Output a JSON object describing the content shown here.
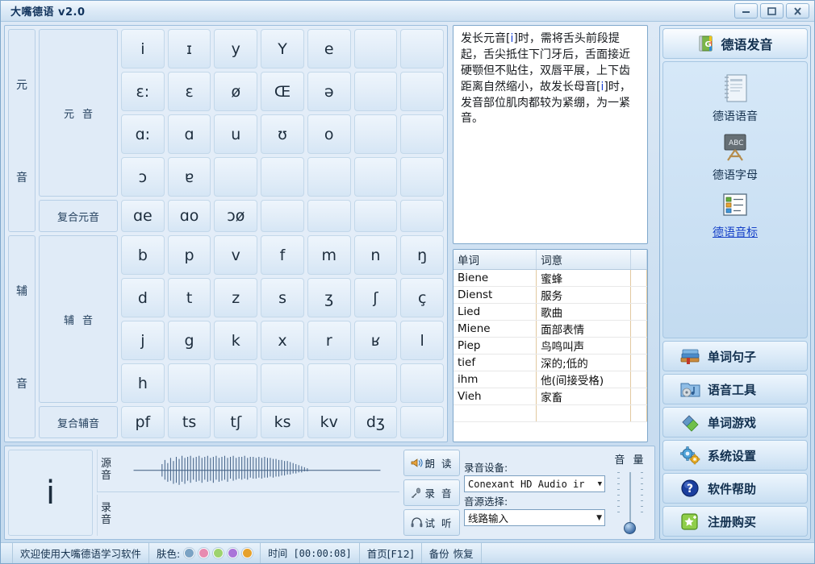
{
  "window": {
    "title": "大嘴德语 v2.0",
    "minimize_label": "最小化",
    "maximize_label": "最大化",
    "close_label": "关闭"
  },
  "phonetics": {
    "vowel_section": {
      "vertical_label_top": "元",
      "vertical_label_bottom": "音",
      "category_main": "元音",
      "category_sub": "复合元音",
      "rows": [
        [
          "i",
          "ɪ",
          "y",
          "Y",
          "e",
          "",
          ""
        ],
        [
          "ɛ:",
          "ɛ",
          "ø",
          "Œ",
          "ə",
          "",
          ""
        ],
        [
          "ɑ:",
          "ɑ",
          "u",
          "ʊ",
          "o",
          "",
          ""
        ],
        [
          "ɔ",
          "ɐ",
          "",
          "",
          "",
          "",
          ""
        ]
      ],
      "diphthong_row": [
        "ɑe",
        "ɑo",
        "ɔø",
        "",
        "",
        "",
        ""
      ]
    },
    "consonant_section": {
      "vertical_label_top": "辅",
      "vertical_label_bottom": "音",
      "category_main": "辅音",
      "category_sub": "复合辅音",
      "rows": [
        [
          "b",
          "p",
          "v",
          "f",
          "m",
          "n",
          "ŋ"
        ],
        [
          "d",
          "t",
          "z",
          "s",
          "ʒ",
          "ʃ",
          "ç"
        ],
        [
          "j",
          "g",
          "k",
          "x",
          "r",
          "ʁ",
          "l"
        ],
        [
          "h",
          "",
          "",
          "",
          "",
          "",
          ""
        ]
      ],
      "compound_row": [
        "pf",
        "ts",
        "tʃ",
        "ks",
        "kv",
        "dʒ",
        ""
      ]
    }
  },
  "description": {
    "line1_a": "发长元音[",
    "line1_hl": "i",
    "line1_b": "]时，需将舌头前段提起，舌尖抵住下门牙后，舌面接近硬颚但不贴住，双唇平展，上下齿距离自然缩小，故发长母音[",
    "line2_hl": "i",
    "line2_b": "]时，发音部位肌肉都较为紧绷，为一紧音。"
  },
  "wordlist": {
    "headers": [
      "单词",
      "词意",
      ""
    ],
    "rows": [
      [
        "Biene",
        "蜜蜂"
      ],
      [
        "Dienst",
        "服务"
      ],
      [
        "Lied",
        "歌曲"
      ],
      [
        "Miene",
        "面部表情"
      ],
      [
        "Piep",
        "鸟鸣叫声"
      ],
      [
        "tief",
        "深的;低的"
      ],
      [
        "ihm",
        "他(间接受格)"
      ],
      [
        "Vieh",
        "家畜"
      ]
    ]
  },
  "audio": {
    "current_symbol": "i",
    "source_label": "源音",
    "record_label": "录音",
    "buttons": [
      {
        "name": "read-aloud",
        "label": "朗 读",
        "icon": "speaker-icon"
      },
      {
        "name": "record",
        "label": "录 音",
        "icon": "microphone-icon"
      },
      {
        "name": "playback",
        "label": "试 听",
        "icon": "headphone-icon"
      }
    ],
    "device_label": "录音设备:",
    "device_value": "Conexant HD Audio ir",
    "source_select_label": "音源选择:",
    "source_select_value": "线路输入",
    "volume_label": "音 量"
  },
  "sidebar": {
    "header": {
      "label": "德语发音",
      "icon": "green-book-icon"
    },
    "items": [
      {
        "label": "德语语音",
        "icon": "notebook-icon",
        "is_link": false
      },
      {
        "label": "德语字母",
        "icon": "abc-board-icon",
        "is_link": false
      },
      {
        "label": "德语音标",
        "icon": "list-icon",
        "is_link": true
      }
    ],
    "buttons": [
      {
        "label": "单词句子",
        "icon": "books-icon"
      },
      {
        "label": "语音工具",
        "icon": "media-folder-icon"
      },
      {
        "label": "单词游戏",
        "icon": "puzzle-icon"
      },
      {
        "label": "系统设置",
        "icon": "gears-icon"
      },
      {
        "label": "软件帮助",
        "icon": "question-icon"
      },
      {
        "label": "注册购买",
        "icon": "star-box-icon"
      }
    ]
  },
  "statusbar": {
    "welcome": "欢迎使用大嘴德语学习软件",
    "skin_label": "肤色:",
    "skin_colors": [
      "#7ba3c4",
      "#e78bb0",
      "#9ed36f",
      "#a974d9",
      "#e6a12c"
    ],
    "time": "时间 [00:00:08]",
    "home": "首页[F12]",
    "backup": "备份",
    "restore": "恢复"
  }
}
